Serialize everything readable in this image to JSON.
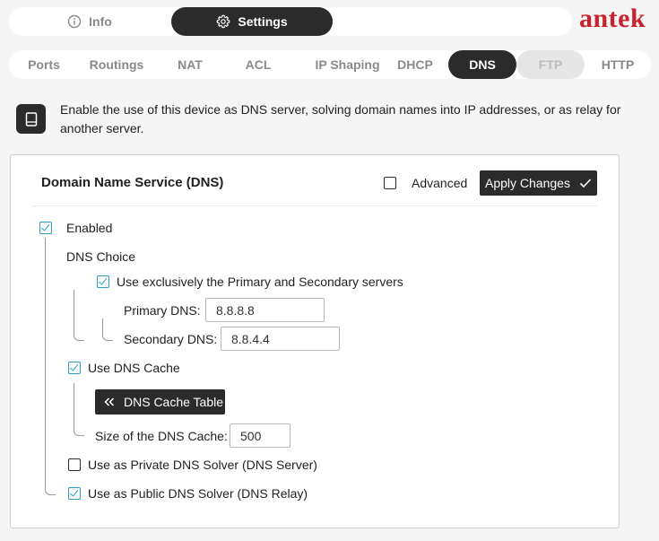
{
  "brand": "antek",
  "top_tabs": [
    {
      "label": "Info",
      "icon": "info-icon"
    },
    {
      "label": "Settings",
      "icon": "gear-icon"
    }
  ],
  "sub_tabs": [
    {
      "label": "Ports",
      "state": "normal"
    },
    {
      "label": "Routings",
      "state": "normal"
    },
    {
      "label": "NAT",
      "state": "normal"
    },
    {
      "label": "ACL",
      "state": "normal"
    },
    {
      "label": "IP Shaping",
      "state": "normal"
    },
    {
      "label": "DHCP",
      "state": "normal"
    },
    {
      "label": "DNS",
      "state": "active"
    },
    {
      "label": "FTP",
      "state": "disabled"
    },
    {
      "label": "HTTP",
      "state": "normal"
    }
  ],
  "notice": {
    "icon": "device-icon",
    "text": "Enable the use of this device as DNS server, solving domain names into IP addresses, or as relay for another server."
  },
  "panel": {
    "title": "Domain Name Service (DNS)",
    "advanced_label": "Advanced",
    "advanced_checked": false,
    "apply_label": "Apply Changes",
    "enabled_label": "Enabled",
    "enabled_checked": true,
    "dns_choice_label": "DNS Choice",
    "exclusive_label": "Use exclusively the Primary and Secondary servers",
    "exclusive_checked": true,
    "primary_label": "Primary DNS:",
    "primary_value": "8.8.8.8",
    "secondary_label": "Secondary DNS:",
    "secondary_value": "8.8.4.4",
    "cache_label": "Use DNS Cache",
    "cache_checked": true,
    "cache_table_label": "DNS Cache Table",
    "cache_size_label": "Size of the DNS Cache:",
    "cache_size_value": "500",
    "private_label": "Use as Private DNS Solver (DNS Server)",
    "private_checked": false,
    "public_label": "Use as Public DNS Solver (DNS Relay)",
    "public_checked": true
  },
  "colors": {
    "accent": "#2aa0c8",
    "dark": "#2b2b2b",
    "brand": "#c8232c"
  }
}
